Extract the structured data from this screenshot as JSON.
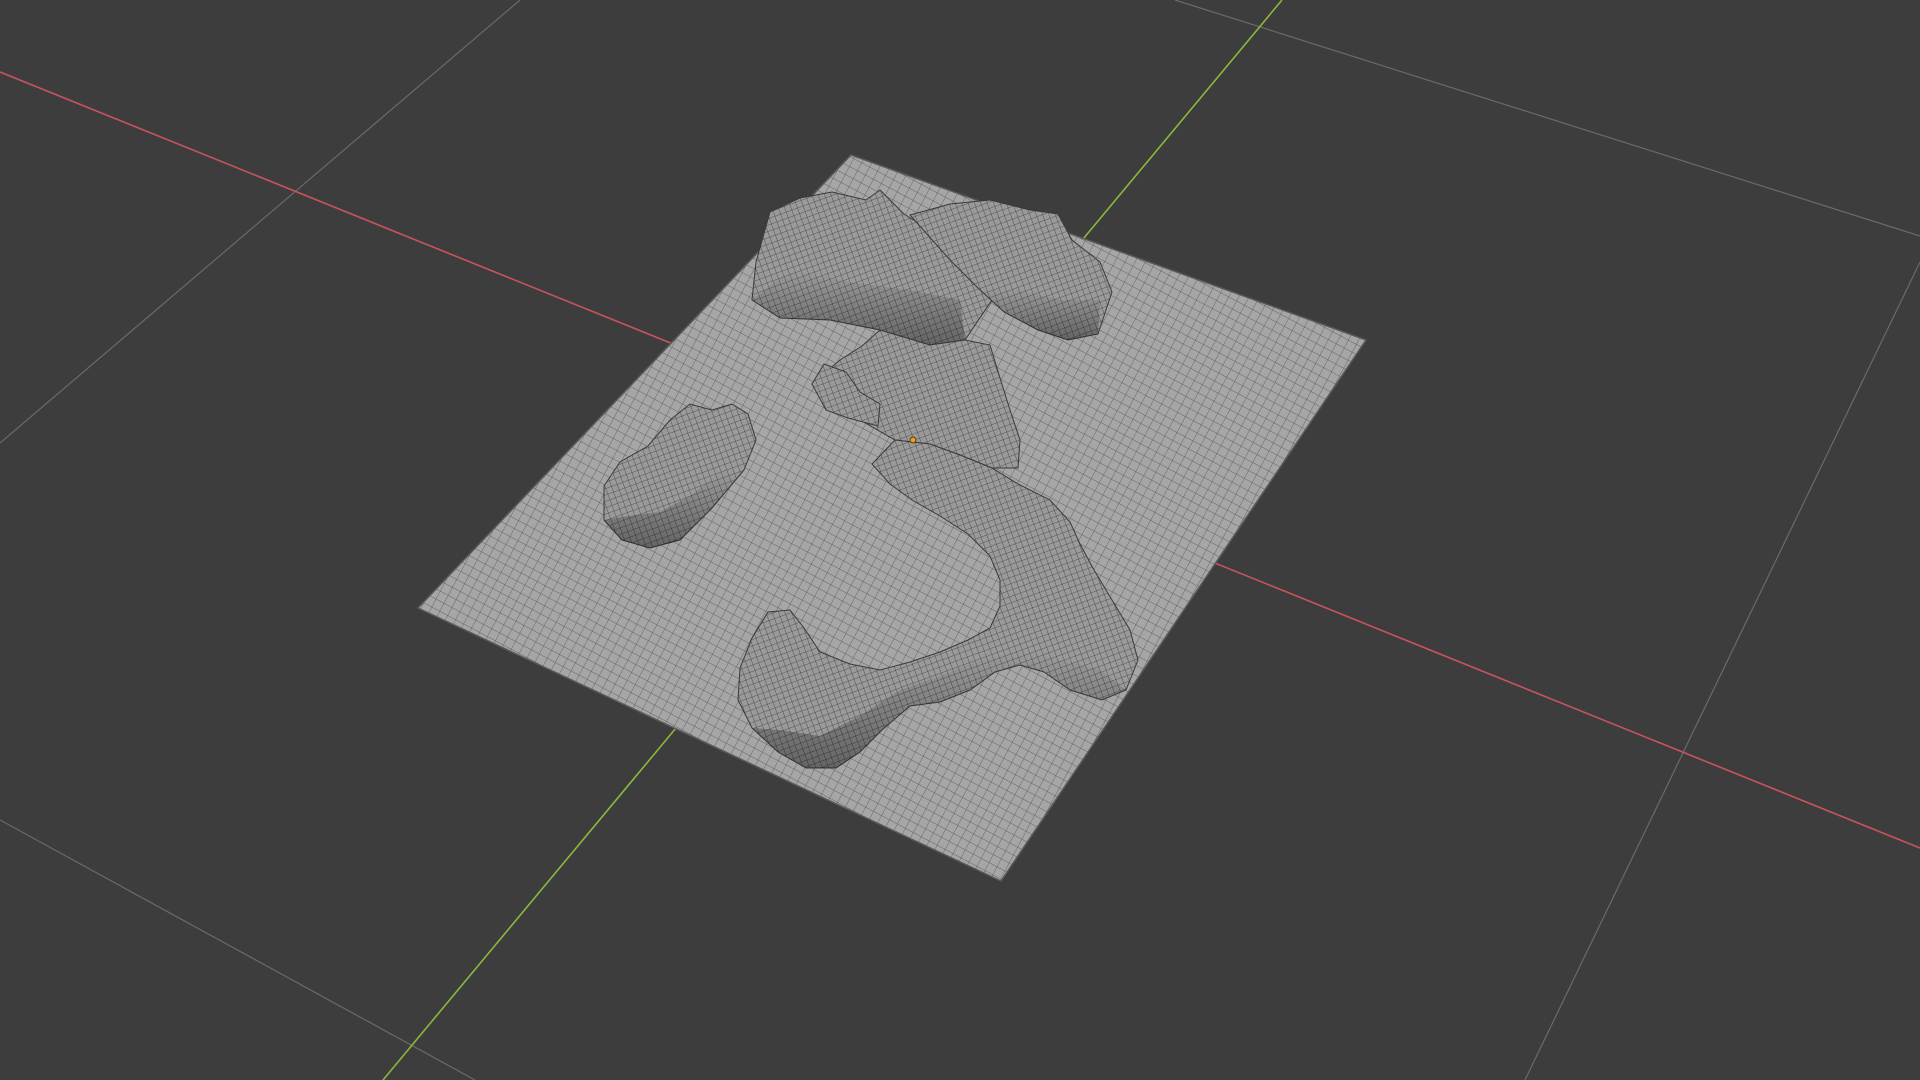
{
  "app": "3D viewport",
  "viewport": {
    "background_color": "#3d3d3d",
    "grid_line_color": "#6a6a6a",
    "x_axis_color": "#c8545c",
    "y_axis_color": "#8ab83a",
    "mesh_fill_color": "#a4a4a4",
    "mesh_wire_color": "#4a4a4a",
    "shading": "wireframe-over-solid",
    "object_origin_color": "#e8a020"
  },
  "scene": {
    "object": {
      "type": "displaced-plane-terrain",
      "features": [
        "ridge-top-left",
        "ridge-top-right",
        "center-ridge",
        "small-mound-left",
        "curved-ridge-bottom"
      ]
    }
  }
}
